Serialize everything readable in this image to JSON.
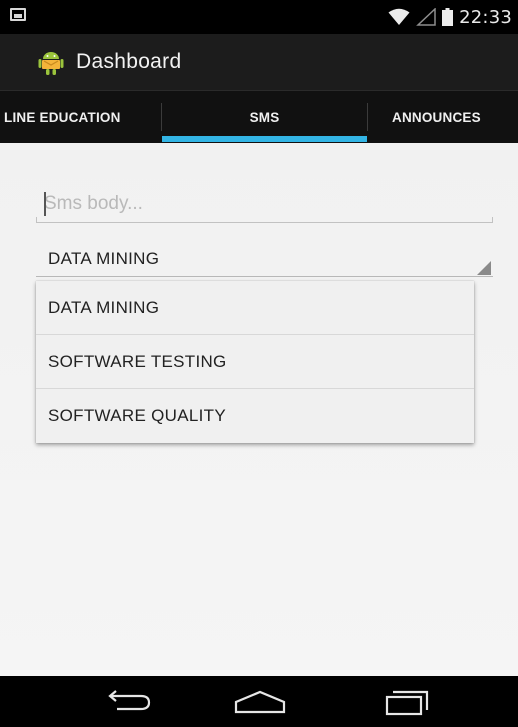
{
  "status_bar": {
    "time": "22:33",
    "left_icon": "image-notification-icon",
    "icons": [
      "wifi-icon",
      "signal-icon",
      "battery-icon"
    ]
  },
  "action_bar": {
    "app_icon": "android-app-icon",
    "title": "Dashboard"
  },
  "tabs": [
    {
      "label": "LINE EDUCATION",
      "selected": false
    },
    {
      "label": "SMS",
      "selected": true
    },
    {
      "label": "ANNOUNCES",
      "selected": false
    }
  ],
  "sms": {
    "placeholder": "Sms body...",
    "value": ""
  },
  "spinner": {
    "selected": "DATA MINING",
    "options": [
      "DATA MINING",
      "SOFTWARE TESTING",
      "SOFTWARE QUALITY"
    ]
  },
  "nav_bar": {
    "buttons": [
      "back-icon",
      "home-icon",
      "recent-apps-icon"
    ]
  },
  "colors": {
    "accent": "#33b5e5",
    "action_bar": "#1c1c1c",
    "content_background": "#f1f1f1"
  }
}
